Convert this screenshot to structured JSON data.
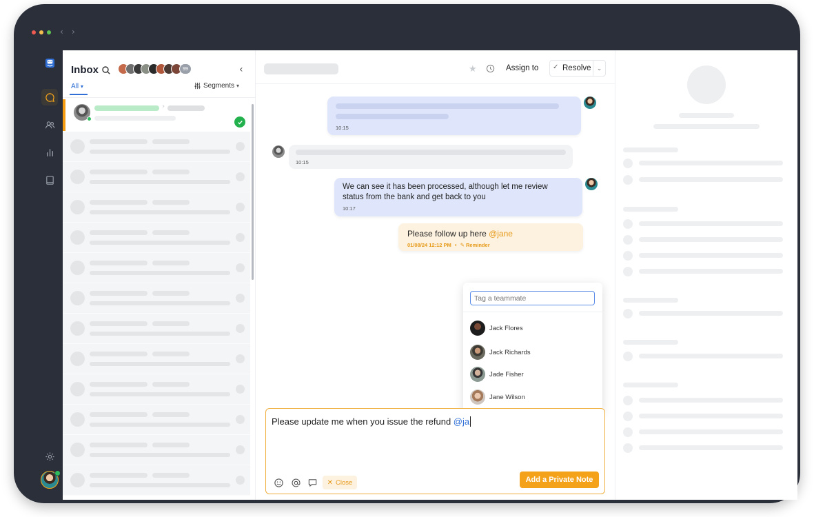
{
  "window": {
    "traffic_colors": [
      "#ee5a52",
      "#f4be4f",
      "#5fc454"
    ],
    "nav": {
      "back": "‹",
      "forward": "›"
    }
  },
  "rail": {
    "items": [
      {
        "id": "chat",
        "icon": "chat-bubble-icon",
        "active": true
      },
      {
        "id": "contacts",
        "icon": "users-icon"
      },
      {
        "id": "reports",
        "icon": "bar-chart-icon"
      },
      {
        "id": "knowledge",
        "icon": "book-icon"
      },
      {
        "id": "settings",
        "icon": "gear-icon"
      }
    ]
  },
  "inbox": {
    "title": "Inbox",
    "avatar_more": "99",
    "filter_label": "All",
    "filter_caret": "▾",
    "segments_label": "Segments",
    "segments_caret": "▾",
    "collapse": "‹"
  },
  "chat": {
    "header": {
      "assign_label": "Assign to",
      "resolve_label": "Resolve",
      "resolve_check": "✓",
      "resolve_caret": "⌄",
      "star": "★"
    },
    "messages": [
      {
        "direction": "out",
        "time": "10:15"
      },
      {
        "direction": "in",
        "time": "10:15"
      },
      {
        "direction": "out",
        "text_line1": "We can see it has been processed, although let me review",
        "text_line2": "status from the bank and get back to you",
        "time": "10:17"
      }
    ],
    "note": {
      "text": "Please follow up here ",
      "mention": "@jane",
      "timestamp": "01/08/24 12:12 PM",
      "separator": "•",
      "reminder_icon": "✎",
      "reminder_label": "Reminder"
    },
    "mention_popup": {
      "placeholder": "Tag a teammate",
      "teammates": [
        "Jack Flores",
        "Jack Richards",
        "Jade Fisher",
        "Jane Wilson"
      ]
    },
    "composer": {
      "text": "Please update me when you issue the refund ",
      "mention": "@ja",
      "close_icon": "✕",
      "close_label": "Close",
      "submit_label": "Add a Private Note"
    }
  },
  "colors": {
    "accent_orange": "#f5a21b",
    "accent_blue": "#2f6fd6",
    "outgoing_bubble": "#dfe6fb",
    "note_bubble": "#fdf1e0",
    "online_green": "#2dbb5d"
  }
}
